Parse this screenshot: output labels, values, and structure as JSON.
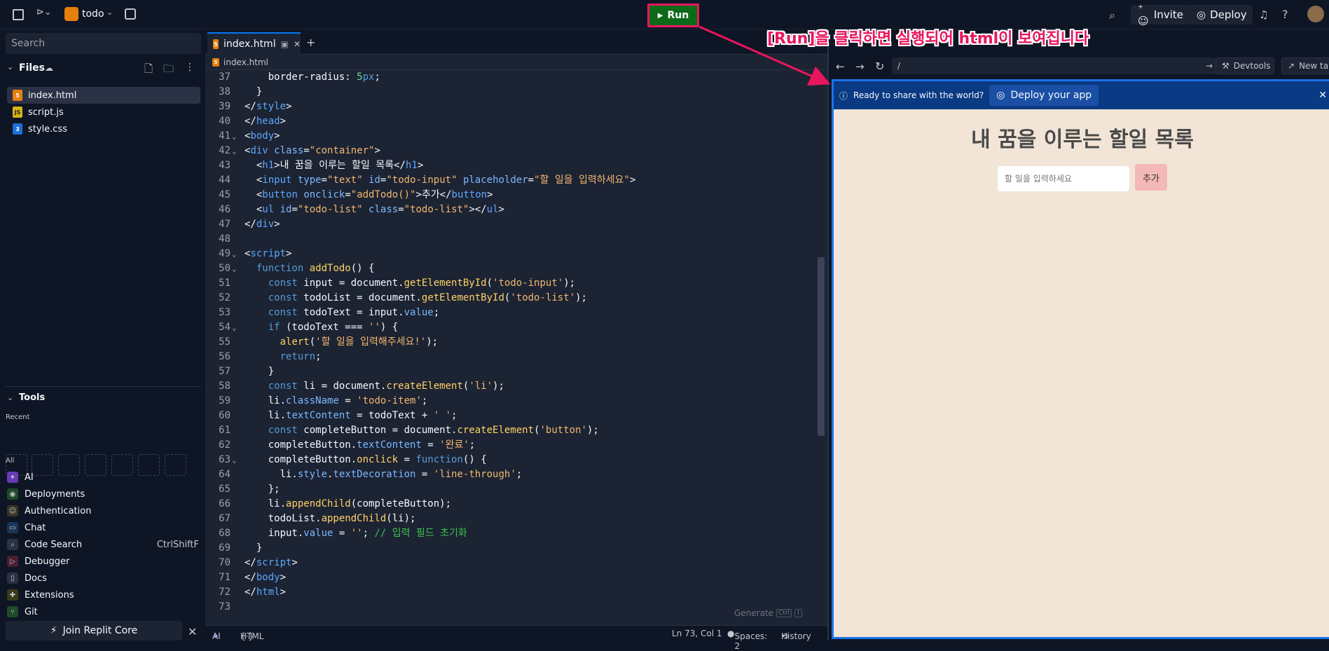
{
  "topbar": {
    "project_name": "todo",
    "run_label": "Run",
    "invite_label": "Invite",
    "deploy_label": "Deploy"
  },
  "sidebar": {
    "search_placeholder": "Search",
    "files_title": "Files",
    "files": [
      {
        "name": "index.html",
        "type": "html"
      },
      {
        "name": "script.js",
        "type": "js"
      },
      {
        "name": "style.css",
        "type": "css"
      }
    ],
    "tools_title": "Tools",
    "recent_label": "Recent",
    "all_label": "All",
    "tools": [
      {
        "label": "AI",
        "icon": "ai-icon"
      },
      {
        "label": "Deployments",
        "icon": "deployments-icon"
      },
      {
        "label": "Authentication",
        "icon": "user-icon"
      },
      {
        "label": "Chat",
        "icon": "chat-icon"
      },
      {
        "label": "Code Search",
        "icon": "search-icon",
        "shortcut": "CtrlShiftF"
      },
      {
        "label": "Debugger",
        "icon": "debugger-icon"
      },
      {
        "label": "Docs",
        "icon": "docs-icon"
      },
      {
        "label": "Extensions",
        "icon": "extensions-icon"
      },
      {
        "label": "Git",
        "icon": "git-icon"
      }
    ],
    "join_core_label": "Join Replit Core"
  },
  "editor": {
    "tab_label": "index.html",
    "breadcrumb": "index.html",
    "generate_hint": "Generate",
    "generate_keys": [
      "Ctrl",
      "I"
    ],
    "lines": [
      {
        "n": "37",
        "fold": "",
        "html": "    border-radius: <span class='num'>5</span><span class='kw'>px</span>;"
      },
      {
        "n": "38",
        "fold": "",
        "html": "  }"
      },
      {
        "n": "39",
        "fold": "",
        "html": "&lt;/<span class='tag'>style</span>&gt;"
      },
      {
        "n": "40",
        "fold": "",
        "html": "&lt;/<span class='tag'>head</span>&gt;"
      },
      {
        "n": "41",
        "fold": "⌄",
        "html": "&lt;<span class='tag'>body</span>&gt;"
      },
      {
        "n": "42",
        "fold": "⌄",
        "html": "&lt;<span class='tag'>div</span> <span class='attr'>class</span>=<span class='str'>\"container\"</span>&gt;"
      },
      {
        "n": "43",
        "fold": "",
        "html": "  &lt;<span class='tag'>h1</span>&gt;내 꿈을 이루는 할일 목록&lt;/<span class='tag'>h1</span>&gt;"
      },
      {
        "n": "44",
        "fold": "",
        "html": "  &lt;<span class='tag'>input</span> <span class='attr'>type</span>=<span class='str'>\"text\"</span> <span class='attr'>id</span>=<span class='str'>\"todo-input\"</span> <span class='attr'>placeholder</span>=<span class='str'>\"할 일을 입력하세요\"</span>&gt;"
      },
      {
        "n": "45",
        "fold": "",
        "html": "  &lt;<span class='tag'>button</span> <span class='attr'>onclick</span>=<span class='str'>\"addTodo()\"</span>&gt;추가&lt;/<span class='tag'>button</span>&gt;"
      },
      {
        "n": "46",
        "fold": "",
        "html": "  &lt;<span class='tag'>ul</span> <span class='attr'>id</span>=<span class='str'>\"todo-list\"</span> <span class='attr'>class</span>=<span class='str'>\"todo-list\"</span>&gt;&lt;/<span class='tag'>ul</span>&gt;"
      },
      {
        "n": "47",
        "fold": "",
        "html": "&lt;/<span class='tag'>div</span>&gt;"
      },
      {
        "n": "48",
        "fold": "",
        "html": ""
      },
      {
        "n": "49",
        "fold": "⌄",
        "html": "&lt;<span class='tag'>script</span>&gt;"
      },
      {
        "n": "50",
        "fold": "⌄",
        "html": "  <span class='kw'>function</span> <span class='fn'>addTodo</span>() {"
      },
      {
        "n": "51",
        "fold": "",
        "html": "    <span class='kw'>const</span> input = document.<span class='fn'>getElementById</span>(<span class='str'>'todo-input'</span>);"
      },
      {
        "n": "52",
        "fold": "",
        "html": "    <span class='kw'>const</span> todoList = document.<span class='fn'>getElementById</span>(<span class='str'>'todo-list'</span>);"
      },
      {
        "n": "53",
        "fold": "",
        "html": "    <span class='kw'>const</span> todoText = input.<span class='attr'>value</span>;"
      },
      {
        "n": "54",
        "fold": "⌄",
        "html": "    <span class='kw'>if</span> (todoText === <span class='str'>''</span>) {"
      },
      {
        "n": "55",
        "fold": "",
        "html": "      <span class='fn'>alert</span>(<span class='str'>'할 일을 입력해주세요!'</span>);"
      },
      {
        "n": "56",
        "fold": "",
        "html": "      <span class='kw'>return</span>;"
      },
      {
        "n": "57",
        "fold": "",
        "html": "    }"
      },
      {
        "n": "58",
        "fold": "",
        "html": "    <span class='kw'>const</span> li = document.<span class='fn'>createElement</span>(<span class='str'>'li'</span>);"
      },
      {
        "n": "59",
        "fold": "",
        "html": "    li.<span class='attr'>className</span> = <span class='str'>'todo-item'</span>;"
      },
      {
        "n": "60",
        "fold": "",
        "html": "    li.<span class='attr'>textContent</span> = todoText + <span class='str'>' '</span>;"
      },
      {
        "n": "61",
        "fold": "",
        "html": "    <span class='kw'>const</span> completeButton = document.<span class='fn'>createElement</span>(<span class='str'>'button'</span>);"
      },
      {
        "n": "62",
        "fold": "",
        "html": "    completeButton.<span class='attr'>textContent</span> = <span class='str'>'완료'</span>;"
      },
      {
        "n": "63",
        "fold": "⌄",
        "html": "    completeButton.<span class='fn'>onclick</span> = <span class='kw'>function</span>() {"
      },
      {
        "n": "64",
        "fold": "",
        "html": "      li.<span class='attr'>style</span>.<span class='attr'>textDecoration</span> = <span class='str'>'line-through'</span>;"
      },
      {
        "n": "65",
        "fold": "",
        "html": "    };"
      },
      {
        "n": "66",
        "fold": "",
        "html": "    li.<span class='fn'>appendChild</span>(completeButton);"
      },
      {
        "n": "67",
        "fold": "",
        "html": "    todoList.<span class='fn'>appendChild</span>(li);"
      },
      {
        "n": "68",
        "fold": "",
        "html": "    input.<span class='attr'>value</span> = <span class='str'>''</span>; <span class='cm'>// 입력 필드 초기화</span>"
      },
      {
        "n": "69",
        "fold": "",
        "html": "  }"
      },
      {
        "n": "70",
        "fold": "",
        "html": "&lt;/<span class='tag'>script</span>&gt;"
      },
      {
        "n": "71",
        "fold": "",
        "html": "&lt;/<span class='tag'>body</span>&gt;"
      },
      {
        "n": "72",
        "fold": "",
        "html": "&lt;/<span class='tag'>html</span>&gt;"
      },
      {
        "n": "73",
        "fold": "",
        "html": ""
      }
    ]
  },
  "statusbar": {
    "ai_label": "AI",
    "language": "HTML",
    "cursor": "Ln 73, Col 1",
    "spaces": "Spaces: 2",
    "history": "History"
  },
  "preview": {
    "url": "/",
    "devtools_label": "Devtools",
    "new_tab_label": "New tab",
    "banner_text": "Ready to share with the world?",
    "deploy_app_label": "Deploy your app",
    "app_title": "내 꿈을 이루는 할일 목록",
    "input_placeholder": "할 일을 입력하세요",
    "add_button": "추가"
  },
  "annotation": {
    "text": "[Run]을 클릭하면 실행되어 html이 보여집니다",
    "color": "#e8165d"
  }
}
